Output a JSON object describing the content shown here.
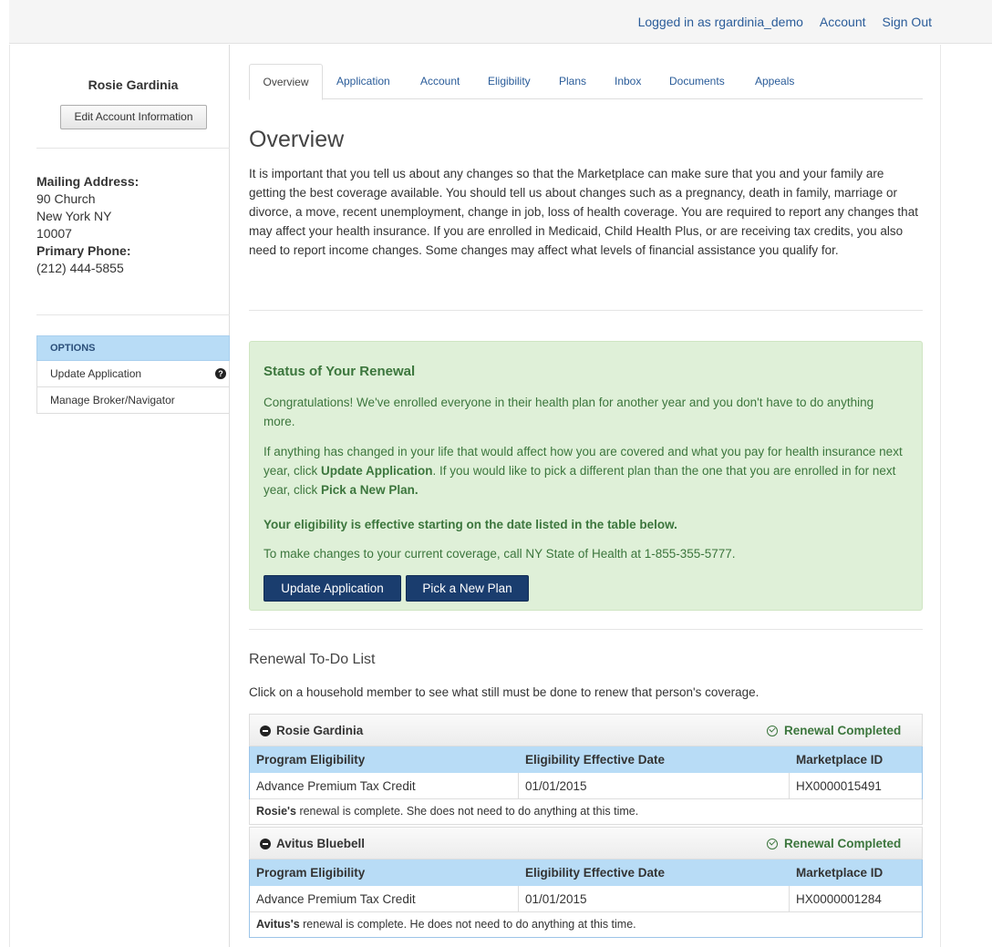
{
  "topnav": {
    "logged_in": "Logged in as rgardinia_demo",
    "account": "Account",
    "sign_out": "Sign Out"
  },
  "sidebar": {
    "name": "Rosie Gardinia",
    "edit_button": "Edit Account Information",
    "mailing_label": "Mailing Address:",
    "address_line1": "90 Church",
    "address_line2": "New York NY",
    "address_line3": "10007",
    "phone_label": "Primary Phone:",
    "phone": "(212) 444-5855",
    "options_heading": "OPTIONS",
    "options": [
      {
        "label": "Update Application",
        "icon": "question-circle-icon"
      },
      {
        "label": "Manage Broker/Navigator"
      }
    ]
  },
  "tabs": [
    "Overview",
    "Application",
    "Account",
    "Eligibility",
    "Plans",
    "Inbox",
    "Documents",
    "Appeals"
  ],
  "overview": {
    "title": "Overview",
    "intro": "It is important that you tell us about any changes so that the Marketplace can make sure that you and your family are getting the best coverage available. You should tell us about changes such as a pregnancy, death in family, marriage or divorce, a move, recent unemployment, change in job, loss of health coverage. You are required to report any changes that may affect your health insurance. If you are enrolled in Medicaid, Child Health Plus, or are receiving tax credits, you also need to report income changes. Some changes may affect what levels of financial assistance you qualify for."
  },
  "renewal_status": {
    "title": "Status of Your Renewal",
    "congrats": "Congratulations! We've enrolled everyone in their health plan for another year and you don't have to do anything more.",
    "changes_p1": "If anything has changed in your life that would affect how you are covered and what you pay for health insurance next year, click ",
    "changes_b1": "Update Application",
    "changes_p2": ". If you would like to pick a different plan than the one that you are enrolled in for next year, click ",
    "changes_b2": "Pick a New Plan.",
    "effective_note": "Your eligibility is effective starting on the date listed in the table below.",
    "call_note": "To make changes to your current coverage, call NY State of Health at 1-855-355-5777.",
    "btn_update": "Update Application",
    "btn_pick": "Pick a New Plan"
  },
  "todo": {
    "title": "Renewal To-Do List",
    "desc": "Click on a household member to see what still must be done to renew that person's coverage.",
    "columns": [
      "Program Eligibility",
      "Eligibility Effective Date",
      "Marketplace ID"
    ],
    "members": [
      {
        "name": "Rosie Gardinia",
        "status": "Renewal Completed",
        "program": "Advance Premium Tax Credit",
        "date": "01/01/2015",
        "id": "HX0000015491",
        "note_bold": "Rosie's",
        "note_rest": " renewal is complete. She does not need to do anything at this time."
      },
      {
        "name": "Avitus Bluebell",
        "status": "Renewal Completed",
        "program": "Advance Premium Tax Credit",
        "date": "01/01/2015",
        "id": "HX0000001284",
        "note_bold": "Avitus's",
        "note_rest": " renewal is complete. He does not need to do anything at this time."
      }
    ]
  },
  "colors": {
    "link": "#2a5c99",
    "alert_bg": "#dff0d8",
    "alert_text": "#3c763d",
    "primary_button": "#1a3d6e",
    "table_header": "#b8dcf6"
  }
}
